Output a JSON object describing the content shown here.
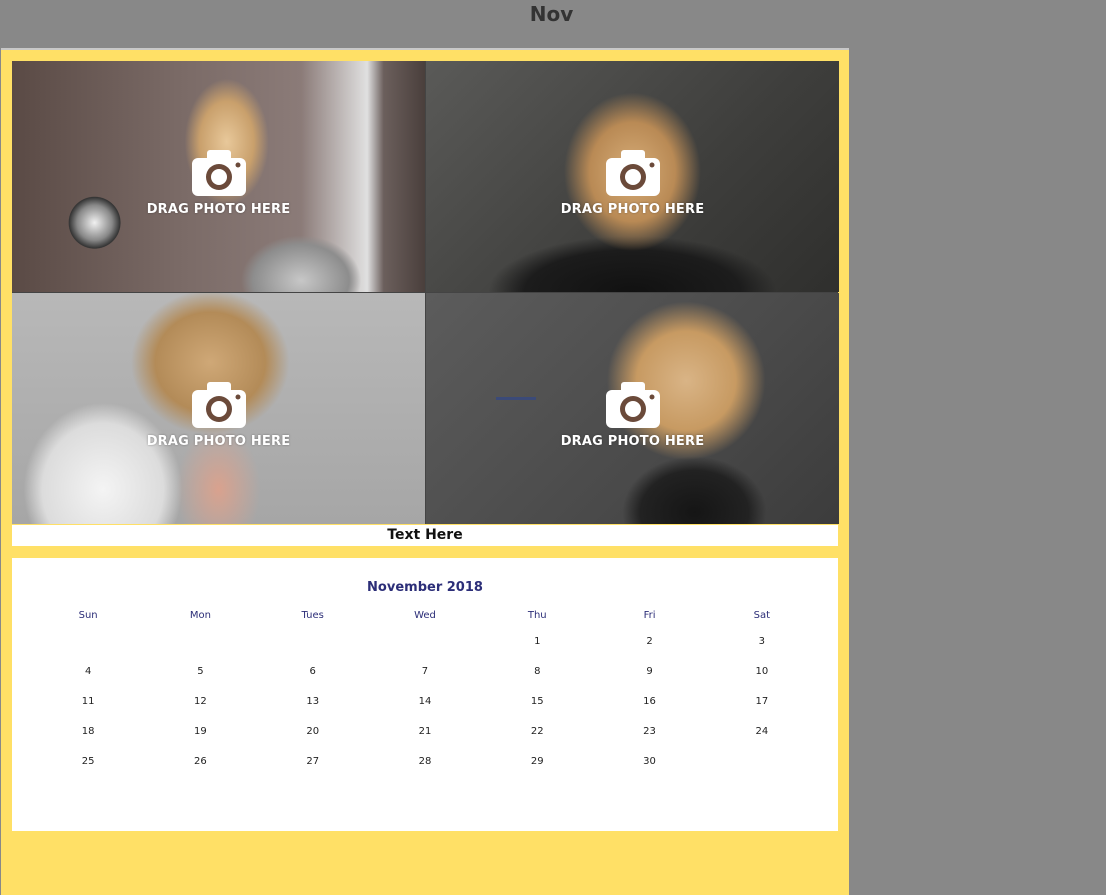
{
  "header": {
    "month_short": "Nov"
  },
  "photos": [
    {
      "label": "DRAG PHOTO HERE"
    },
    {
      "label": "DRAG PHOTO HERE"
    },
    {
      "label": "DRAG PHOTO HERE"
    },
    {
      "label": "DRAG PHOTO HERE"
    }
  ],
  "caption": "Text Here",
  "calendar": {
    "title": "November 2018",
    "weekdays": [
      "Sun",
      "Mon",
      "Tues",
      "Wed",
      "Thu",
      "Fri",
      "Sat"
    ],
    "weeks": [
      [
        "",
        "",
        "",
        "",
        "1",
        "2",
        "3"
      ],
      [
        "4",
        "5",
        "6",
        "7",
        "8",
        "9",
        "10"
      ],
      [
        "11",
        "12",
        "13",
        "14",
        "15",
        "16",
        "17"
      ],
      [
        "18",
        "19",
        "20",
        "21",
        "22",
        "23",
        "24"
      ],
      [
        "25",
        "26",
        "27",
        "28",
        "29",
        "30",
        ""
      ]
    ]
  },
  "colors": {
    "page_background": "#ffe066",
    "window_background": "#888888",
    "calendar_text": "#2c2e78"
  },
  "icons": {
    "drop_zone": "camera-icon"
  }
}
